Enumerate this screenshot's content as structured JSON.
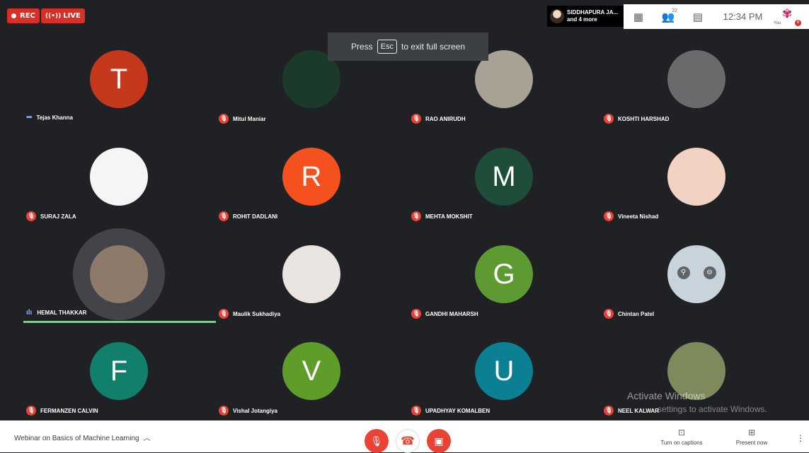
{
  "topbar": {
    "rec_label": "REC",
    "live_label": "LIVE",
    "presenter_line1": "SIDDHAPURA JA...",
    "presenter_line2": "and 4 more",
    "participants_count": "22",
    "clock": "12:34 PM",
    "self_label": "You",
    "self_badge": "6"
  },
  "toast": {
    "prefix": "Press",
    "key": "Esc",
    "suffix": "to exit full screen"
  },
  "tiles": [
    {
      "name": "Tejas Khanna",
      "initial": "T",
      "color": "#c5381b",
      "status": "dots"
    },
    {
      "name": "Mitul Maniar",
      "initial": "",
      "color": "#1c3a2c",
      "status": "muted"
    },
    {
      "name": "RAO ANIRUDH",
      "initial": "",
      "color": "#a8a295",
      "status": "muted"
    },
    {
      "name": "KOSHTI HARSHAD",
      "initial": "",
      "color": "#6b6b6b",
      "status": "muted"
    },
    {
      "name": "SURAJ ZALA",
      "initial": "",
      "color": "#f5f5f5",
      "status": "muted"
    },
    {
      "name": "ROHIT DADLANI",
      "initial": "R",
      "color": "#f4511e",
      "status": "muted"
    },
    {
      "name": "MEHTA MOKSHIT",
      "initial": "M",
      "color": "#1e4d3a",
      "status": "muted"
    },
    {
      "name": "Vineeta Nishad",
      "initial": "",
      "color": "#f2d3c3",
      "status": "muted"
    },
    {
      "name": "HEMAL THAKKAR",
      "initial": "",
      "color": "#8d7a6a",
      "status": "speaking"
    },
    {
      "name": "Maulik Sukhadiya",
      "initial": "",
      "color": "#e9e4df",
      "status": "muted"
    },
    {
      "name": "GANDHI MAHARSH",
      "initial": "G",
      "color": "#5d9b32",
      "status": "muted"
    },
    {
      "name": "Chintan Patel",
      "initial": "",
      "color": "#c9d3dc",
      "status": "muted"
    },
    {
      "name": "FERMANZEN CALVIN",
      "initial": "F",
      "color": "#10806b",
      "status": "muted"
    },
    {
      "name": "Vishal Jotangiya",
      "initial": "V",
      "color": "#5e9d2a",
      "status": "muted"
    },
    {
      "name": "UPADHYAY KOMALBEN",
      "initial": "U",
      "color": "#0b8093",
      "status": "muted"
    },
    {
      "name": "NEEL KALWAR",
      "initial": "",
      "color": "#7d8a5c",
      "status": "muted"
    }
  ],
  "watermark": {
    "line1": "Activate Windows",
    "line2": "settings to activate Windows."
  },
  "bottombar": {
    "meeting_title": "Webinar on Basics of Machine Learning",
    "captions_label": "Turn on captions",
    "present_label": "Present now"
  }
}
